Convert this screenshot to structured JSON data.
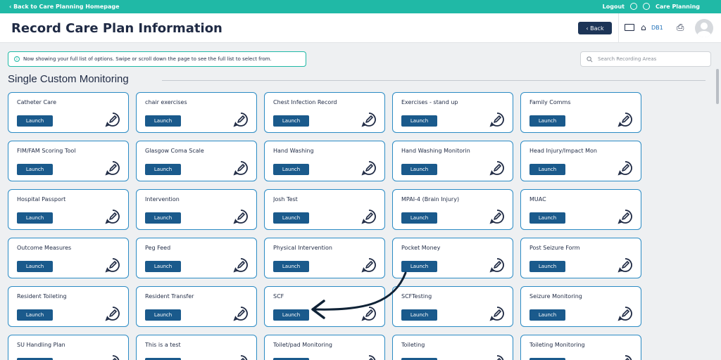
{
  "topbar": {
    "back_link": "‹ Back to Care Planning Homepage",
    "logout": "Logout",
    "app_name": "Care Planning"
  },
  "header": {
    "title": "Record Care Plan Information",
    "back_button": "‹ Back",
    "home_label": "DB1"
  },
  "notice": {
    "text": "Now showing your full list of options. Swipe or scroll down the page to see the full list to select from."
  },
  "search": {
    "placeholder": "Search Recording Areas"
  },
  "section": {
    "title": "Single Custom Monitoring"
  },
  "launch_label": "Launch",
  "cards": [
    {
      "title": "Catheter Care"
    },
    {
      "title": "chair exercises"
    },
    {
      "title": "Chest Infection Record"
    },
    {
      "title": "Exercises - stand up"
    },
    {
      "title": "Family Comms"
    },
    {
      "title": "FIM/FAM Scoring Tool"
    },
    {
      "title": "Glasgow Coma Scale"
    },
    {
      "title": "Hand Washing"
    },
    {
      "title": "Hand Washing Monitorin"
    },
    {
      "title": "Head Injury/Impact Mon"
    },
    {
      "title": "Hospital Passport"
    },
    {
      "title": "Intervention"
    },
    {
      "title": "Josh Test"
    },
    {
      "title": "MPAI-4 (Brain Injury)"
    },
    {
      "title": "MUAC"
    },
    {
      "title": "Outcome Measures"
    },
    {
      "title": "Peg Feed"
    },
    {
      "title": "Physical Intervention"
    },
    {
      "title": "Pocket Money"
    },
    {
      "title": "Post Seizure Form"
    },
    {
      "title": "Resident Toileting"
    },
    {
      "title": "Resident Transfer"
    },
    {
      "title": "SCF"
    },
    {
      "title": "SCFTesting"
    },
    {
      "title": "Seizure Monitoring"
    },
    {
      "title": "SU Handling Plan"
    },
    {
      "title": "This is a test"
    },
    {
      "title": "Toilet/pad Monitoring"
    },
    {
      "title": "Toileting"
    },
    {
      "title": "Toileting Monitoring"
    }
  ],
  "colors": {
    "accent": "#20b9a6",
    "primary": "#1a5a8c",
    "card_border": "#2b8bc4"
  }
}
